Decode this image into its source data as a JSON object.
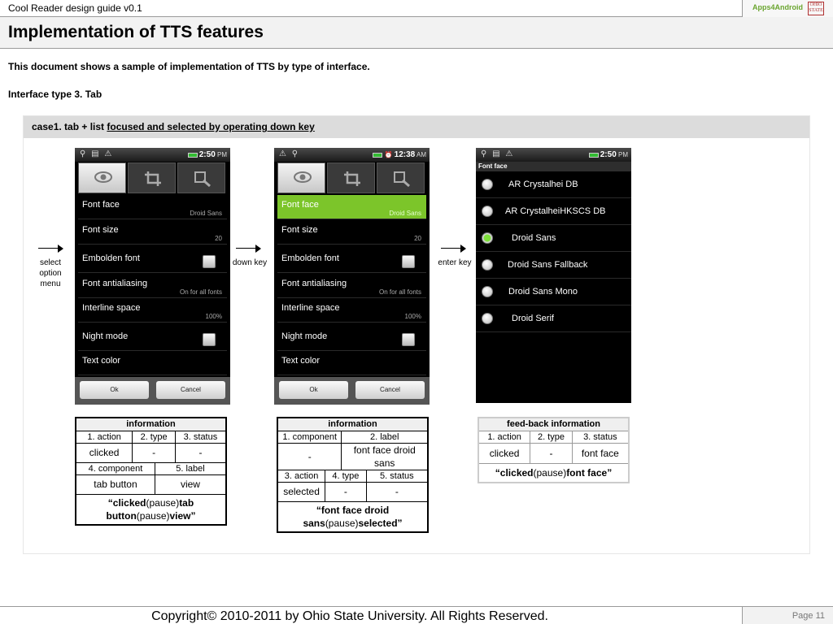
{
  "header": {
    "doc_title": "Cool Reader design guide v0.1",
    "logo_apps": "Apps4Android",
    "logo_osu": "OHIO STATE"
  },
  "title": "Implementation of TTS features",
  "intro": "This document shows a sample of implementation of TTS by type of interface.",
  "interface_type": "Interface type 3. Tab",
  "case": {
    "prefix": "case1. tab  + list ",
    "underlined": "focused and selected by operating down key"
  },
  "phone1": {
    "time": "2:50",
    "ampm": "PM",
    "options": [
      {
        "label": "Font face",
        "value": "Droid Sans"
      },
      {
        "label": "Font size",
        "value": "20"
      },
      {
        "label": "Embolden font",
        "value": ""
      },
      {
        "label": "Font antialiasing",
        "value": "On for all fonts"
      },
      {
        "label": "Interline space",
        "value": "100%"
      },
      {
        "label": "Night mode",
        "value": ""
      },
      {
        "label": "Text color",
        "value": ""
      }
    ],
    "ok": "Ok",
    "cancel": "Cancel"
  },
  "phone2": {
    "time": "12:38",
    "ampm": "AM",
    "options": [
      {
        "label": "Font face",
        "value": "Droid Sans"
      },
      {
        "label": "Font size",
        "value": "20"
      },
      {
        "label": "Embolden font",
        "value": ""
      },
      {
        "label": "Font antialiasing",
        "value": "On for all fonts"
      },
      {
        "label": "Interline space",
        "value": "100%"
      },
      {
        "label": "Night mode",
        "value": ""
      },
      {
        "label": "Text color",
        "value": ""
      }
    ],
    "ok": "Ok",
    "cancel": "Cancel"
  },
  "phone3": {
    "time": "2:50",
    "ampm": "PM",
    "title": "Font face",
    "fonts": [
      "AR Crystalhei DB",
      "AR CrystalheiHKSCS DB",
      "Droid Sans",
      "Droid Sans Fallback",
      "Droid Sans Mono",
      "Droid Serif"
    ]
  },
  "arrows": {
    "a1": "select option menu",
    "a2": "down key",
    "a3": "enter key"
  },
  "table1": {
    "header": "information",
    "h1": "1. action",
    "h2": "2. type",
    "h3": "3. status",
    "v1": "clicked",
    "v2": "-",
    "v3": "-",
    "h4": "4. component",
    "h5": "5. label",
    "v4": "tab button",
    "v5": "view",
    "p1": "“clicked",
    "p2": "(pause)",
    "p3": "tab button",
    "p4": "(pause)",
    "p5": "view”"
  },
  "table2": {
    "header": "information",
    "h1": "1. component",
    "h2": "2. label",
    "v1": "-",
    "v2": "font face droid sans",
    "h3": "3. action",
    "h4": "4. type",
    "h5": "5. status",
    "v3": "selected",
    "v4": "-",
    "v5": "-",
    "p1": "“font face droid sans",
    "p2": "(pause)",
    "p3": "selected”"
  },
  "table3": {
    "header": "feed-back information",
    "h1": "1. action",
    "h2": "2. type",
    "h3": "3. status",
    "v1": "clicked",
    "v2": "-",
    "v3": "font face",
    "p1": "“clicked",
    "p2": "(pause)",
    "p3": "font face”"
  },
  "footer": {
    "copyright": "Copyright© 2010-2011 by Ohio State University. All Rights Reserved.",
    "page": "Page 11"
  },
  "colors": {
    "highlight": "#7cc52a",
    "panel_header": "#dcdcdc"
  }
}
